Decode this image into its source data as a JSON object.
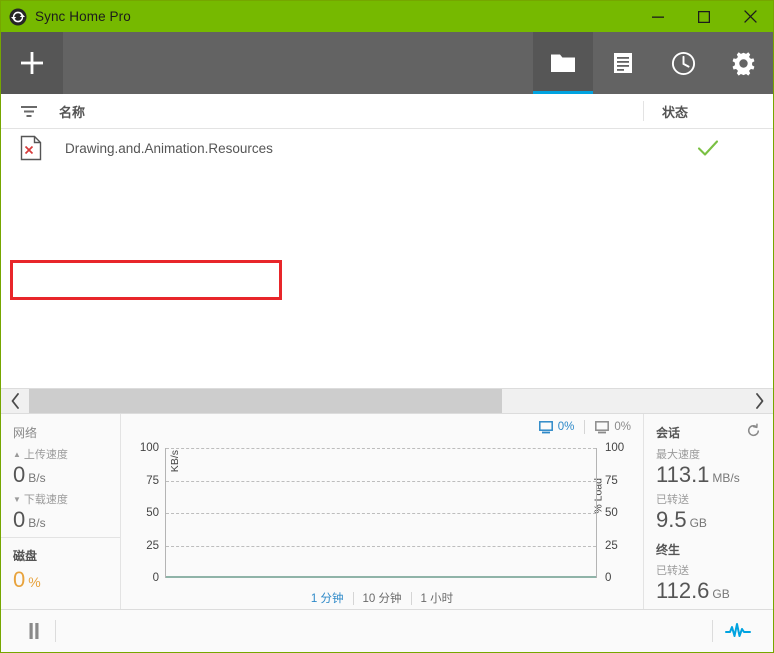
{
  "window": {
    "title": "Sync Home Pro",
    "app_icon": "sync-circle-icon",
    "accent_green": "#76b900",
    "accent_blue": "#00a3e0",
    "controls": {
      "minimize": "minimize-icon",
      "maximize": "maximize-icon",
      "close": "close-icon"
    }
  },
  "toolbar": {
    "add_label": "+",
    "tabs": [
      {
        "icon": "folder-icon",
        "active": true
      },
      {
        "icon": "list-document-icon",
        "active": false
      },
      {
        "icon": "clock-icon",
        "active": false
      },
      {
        "icon": "gear-icon",
        "active": false
      }
    ]
  },
  "columns": {
    "filter_icon": "filter-icon",
    "name": "名称",
    "status": "状态"
  },
  "files": [
    {
      "icon": "broken-file-icon",
      "name": "Drawing.and.Animation.Resources",
      "status_icon": "check-icon",
      "highlighted": true
    }
  ],
  "scrollbar": {
    "left_arrow": "chevron-left-icon",
    "right_arrow": "chevron-right-icon",
    "thumb_percent": 66
  },
  "network_panel": {
    "title": "网络",
    "upload": {
      "arrow": "▲",
      "label": "上传速度",
      "value": "0",
      "unit": "B/s"
    },
    "download": {
      "arrow": "▼",
      "label": "下载速度",
      "value": "0",
      "unit": "B/s"
    },
    "disk": {
      "title": "磁盘",
      "value": "0",
      "unit": "%"
    }
  },
  "session_panel": {
    "title": "会话",
    "reset_icon": "reset-icon",
    "max_speed": {
      "label": "最大速度",
      "value": "113.1",
      "unit": "MB/s"
    },
    "transferred": {
      "label": "已转送",
      "value": "9.5",
      "unit": "GB"
    },
    "lifetime": {
      "title": "终生",
      "label": "已转送",
      "value": "112.6",
      "unit": "GB"
    }
  },
  "chart_data": {
    "type": "line",
    "title": "",
    "xlabel": "",
    "ylabel": "KB/s",
    "y2label": "% Load",
    "ylim": [
      0,
      100
    ],
    "y2lim": [
      0,
      100
    ],
    "yticks": [
      "100",
      "75",
      "50",
      "25",
      "0"
    ],
    "y2ticks": [
      "100",
      "75",
      "50",
      "25",
      "0"
    ],
    "grid": true,
    "legend_position": "top-right",
    "legend": [
      {
        "icon": "monitor-icon",
        "label": "0%",
        "color": "#2d89c8",
        "active": true
      },
      {
        "icon": "monitor-icon",
        "label": "0%",
        "color": "#8a8a8a",
        "active": false
      }
    ],
    "series": [
      {
        "name": "KB/s",
        "color": "#8fb3a8",
        "values": [
          0,
          0,
          0,
          0,
          0,
          0,
          0,
          0,
          0,
          0,
          0,
          0,
          0,
          0,
          0,
          0,
          0,
          0,
          0,
          0
        ]
      }
    ],
    "time_tabs": [
      {
        "label": "1 分钟",
        "active": true
      },
      {
        "label": "10 分钟",
        "active": false
      },
      {
        "label": "1 小时",
        "active": false
      }
    ]
  },
  "statusbar": {
    "pause_icon": "pause-icon",
    "activity_icon": "activity-pulse-icon"
  }
}
